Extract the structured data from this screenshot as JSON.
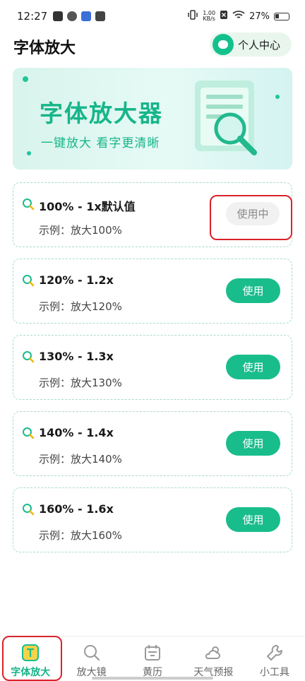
{
  "status_bar": {
    "time": "12:27",
    "net_speed": "1.00",
    "net_unit": "KB/s",
    "battery": "27%"
  },
  "header": {
    "title": "字体放大",
    "profile_label": "个人中心"
  },
  "banner": {
    "title": "字体放大器",
    "subtitle": "一键放大  看字更清晰"
  },
  "options": [
    {
      "title": "100% - 1x默认值",
      "example": "示例：放大100%",
      "button": "使用中",
      "active": true
    },
    {
      "title": "120% - 1.2x",
      "example": "示例：放大120%",
      "button": "使用",
      "active": false
    },
    {
      "title": "130% - 1.3x",
      "example": "示例：放大130%",
      "button": "使用",
      "active": false
    },
    {
      "title": "140% - 1.4x",
      "example": "示例：放大140%",
      "button": "使用",
      "active": false
    },
    {
      "title": "160% - 1.6x",
      "example": "示例：放大160%",
      "button": "使用",
      "active": false
    }
  ],
  "tabs": [
    {
      "label": "字体放大",
      "icon": "font-icon",
      "active": true
    },
    {
      "label": "放大镜",
      "icon": "magnifier-icon",
      "active": false
    },
    {
      "label": "黄历",
      "icon": "calendar-icon",
      "active": false
    },
    {
      "label": "天气预报",
      "icon": "weather-icon",
      "active": false
    },
    {
      "label": "小工具",
      "icon": "wrench-icon",
      "active": false
    }
  ],
  "colors": {
    "accent": "#19bd8c",
    "highlight": "#d9232a",
    "card_border": "#a9dcc8"
  }
}
